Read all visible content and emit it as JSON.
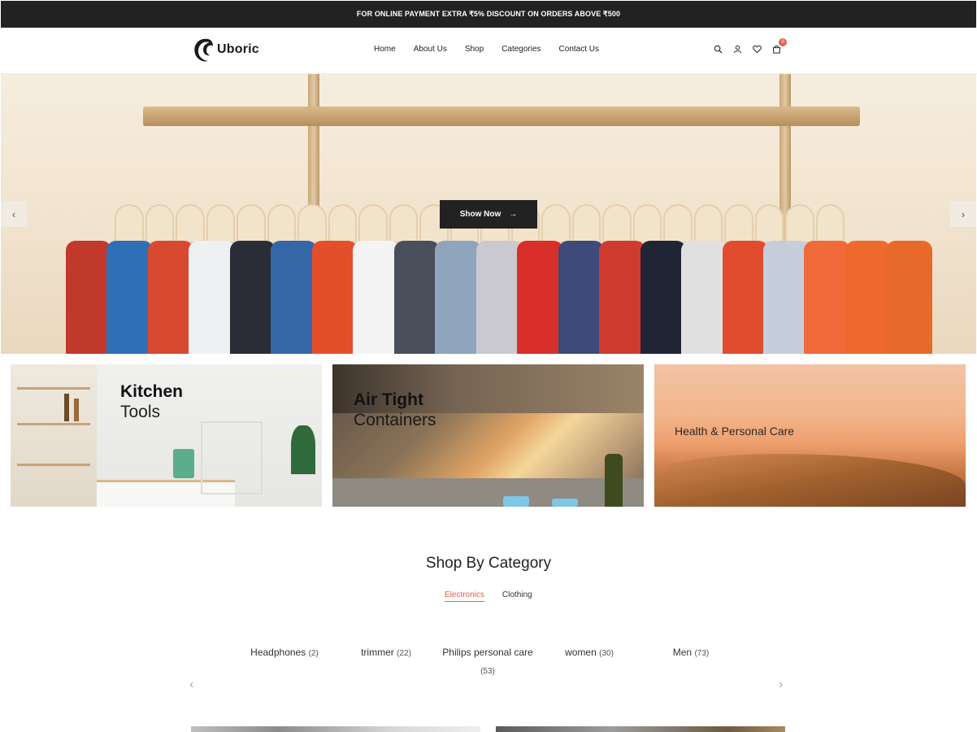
{
  "announcement": "FOR ONLINE PAYMENT EXTRA ₹5% DISCOUNT ON ORDERS ABOVE ₹500",
  "brand": {
    "name": "Uboric"
  },
  "nav": [
    "Home",
    "About Us",
    "Shop",
    "Categories",
    "Contact Us"
  ],
  "header_icons": [
    "search-icon",
    "user-icon",
    "heart-icon",
    "cart-icon"
  ],
  "cart_count": "0",
  "hero": {
    "cta": "Show Now",
    "prev": "‹",
    "next": "›"
  },
  "banners": [
    {
      "bold": "Kitchen",
      "light": "Tools"
    },
    {
      "bold": "Air Tight",
      "light": "Containers"
    },
    {
      "label": "Health & Personal Care"
    }
  ],
  "shop_by_category": {
    "title": "Shop By Category",
    "tabs": [
      "Electronics",
      "Clothing"
    ],
    "active_tab": "Electronics",
    "items": [
      {
        "name": "Headphones",
        "count": "(2)"
      },
      {
        "name": "trimmer",
        "count": "(22)"
      },
      {
        "name": "Philips personal care",
        "count": "(53)"
      },
      {
        "name": "women",
        "count": "(30)"
      },
      {
        "name": "Men",
        "count": "(73)"
      }
    ]
  },
  "colors": {
    "accent": "#e8604c",
    "dark": "#222222"
  }
}
